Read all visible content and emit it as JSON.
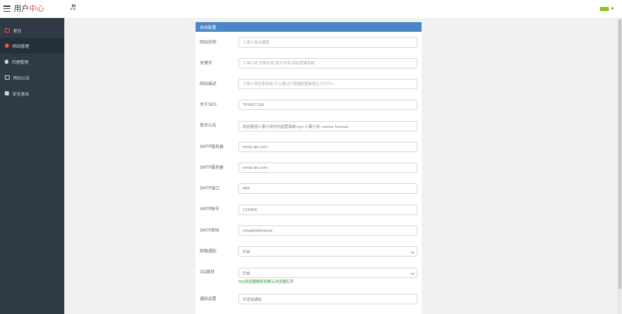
{
  "brand": {
    "part1": "用户",
    "part2": "中心"
  },
  "sidebar": {
    "items": [
      {
        "label": "首页",
        "active": false
      },
      {
        "label": "网站管理",
        "active": true
      },
      {
        "label": "代理管理",
        "active": false
      },
      {
        "label": "网站公告",
        "active": false
      },
      {
        "label": "安全退出",
        "active": false
      }
    ]
  },
  "panel": {
    "title": "系统配置"
  },
  "form": {
    "site_name": {
      "label": "网站名称",
      "placeholder": "人事小说云编程"
    },
    "keywords": {
      "label": "关键字",
      "placeholder": "人事小说,代刷业务,提升业务,网站搭建系统"
    },
    "site_desc": {
      "label": "网站描述",
      "placeholder": "人事小说优质系统,可以通过行程器配置能够让分行行>"
    },
    "seo": {
      "label": "关于SEO",
      "value": "763437 Q&"
    },
    "notice": {
      "label": "首页公告",
      "value": "欢迎使用人事小说内内运营系统<p>人事小说: xxxxx 5xxxxx"
    },
    "smtp_server": {
      "label": "SMTP服务器",
      "value": "smtp.qq.com"
    },
    "smtp_host": {
      "label": "SMTP服务器",
      "value": "smtp.qq.com"
    },
    "smtp_port": {
      "label": "SMTP端口",
      "value": "465"
    },
    "smtp_account": {
      "label": "SMTP账号",
      "value": "123456"
    },
    "smtp_password": {
      "label": "SMTP密码",
      "value": "nkugetablearpe"
    },
    "email_notify": {
      "label": "邮箱通知",
      "value": "开启"
    },
    "qq_jump": {
      "label": "QQ跳转",
      "value": "开启",
      "help": "QQ浏览器跳转到默认浏览器打开"
    },
    "notify_settings": {
      "label": "通知设置",
      "value": "不添加通知"
    }
  },
  "colors": {
    "sidebar_bg": "#2f3a44",
    "panel_header": "#4a86c5",
    "brand_accent": "#e04a4a",
    "help_text": "#2e8b2e"
  }
}
